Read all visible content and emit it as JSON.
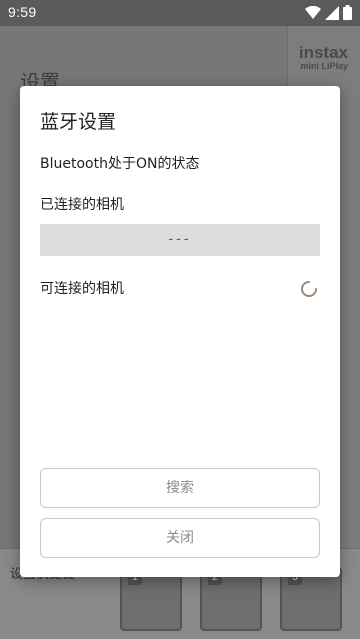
{
  "status_bar": {
    "time": "9:59",
    "icons": [
      "wifi-icon",
      "signal-icon",
      "battery-icon"
    ]
  },
  "background_app": {
    "title": "设置",
    "logo_main": "instax",
    "logo_sub": "mini LiPlay",
    "bottom_label": "设置快捷键",
    "slots": [
      "1",
      "2",
      "3"
    ]
  },
  "dialog": {
    "title": "蓝牙设置",
    "bluetooth_status": "Bluetooth处于ON的状态",
    "connected_label": "已连接的相机",
    "connected_value": "---",
    "available_label": "可连接的相机",
    "search_button": "搜索",
    "close_button": "关闭"
  },
  "colors": {
    "button_border": "#cfc7b8",
    "row_bg": "#dcdcdc",
    "spinner": "#9a8a70"
  }
}
